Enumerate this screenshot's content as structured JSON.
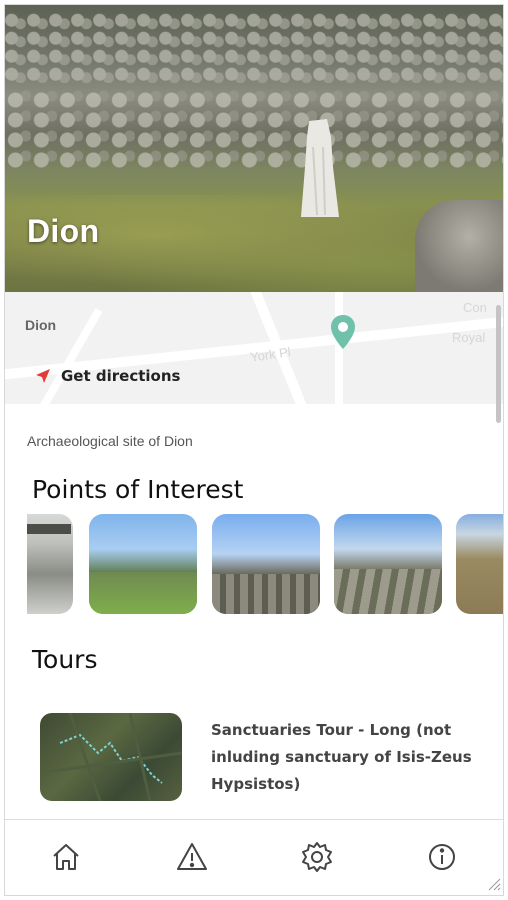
{
  "place": {
    "title": "Dion",
    "map_label": "Dion",
    "directions_label": "Get directions",
    "description": "Archaeological site of Dion"
  },
  "map": {
    "faint_labels": [
      "York Pl",
      "Royal",
      "Con"
    ]
  },
  "sections": {
    "poi_title": "Points of Interest",
    "tours_title": "Tours"
  },
  "tours": [
    {
      "title": "Sanctuaries Tour - Long (not inluding sanctuary of Isis-Zeus Hypsistos)"
    }
  ],
  "nav": {
    "items": [
      {
        "icon": "home-icon"
      },
      {
        "icon": "warning-icon"
      },
      {
        "icon": "gear-icon"
      },
      {
        "icon": "info-icon"
      }
    ]
  },
  "colors": {
    "pin": "#6fc1a9",
    "directions_arrow": "#e53935",
    "text": "#222222"
  }
}
